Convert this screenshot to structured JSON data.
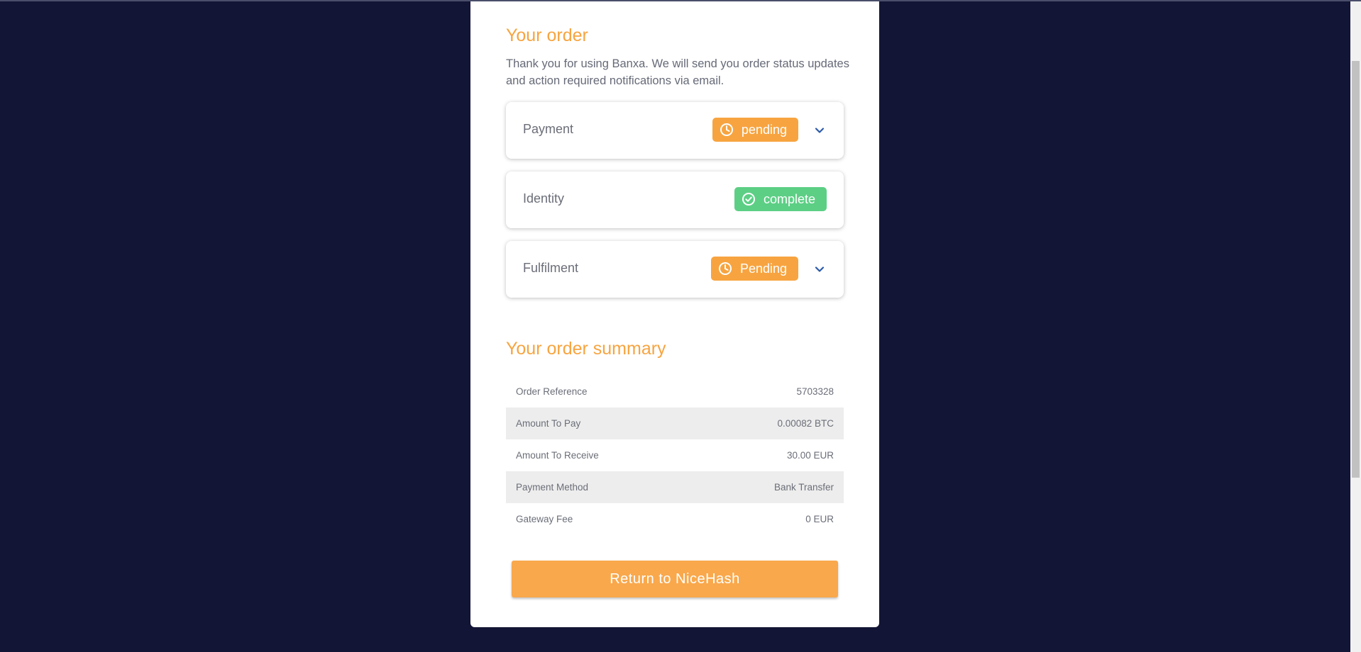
{
  "order": {
    "title": "Your order",
    "intro": "Thank you for using Banxa. We will send you order status updates and action required notifications via email."
  },
  "statuses": [
    {
      "label": "Payment",
      "status": "pending",
      "icon": "clock-icon",
      "color": "#f7a440",
      "expandable": true
    },
    {
      "label": "Identity",
      "status": "complete",
      "icon": "check-circle-icon",
      "color": "#5ccf85",
      "expandable": false
    },
    {
      "label": "Fulfilment",
      "status": "Pending",
      "icon": "clock-icon",
      "color": "#f7a440",
      "expandable": true
    }
  ],
  "summary": {
    "title": "Your order summary",
    "rows": [
      {
        "label": "Order Reference",
        "value": "5703328"
      },
      {
        "label": "Amount To Pay",
        "value": "0.00082 BTC"
      },
      {
        "label": "Amount To Receive",
        "value": "30.00 EUR"
      },
      {
        "label": "Payment Method",
        "value": "Bank Transfer"
      },
      {
        "label": "Gateway Fee",
        "value": "0 EUR"
      }
    ]
  },
  "actions": {
    "return_label": "Return to NiceHash"
  },
  "colors": {
    "accent": "#f7a440",
    "success": "#5ccf85",
    "background": "#131536"
  }
}
